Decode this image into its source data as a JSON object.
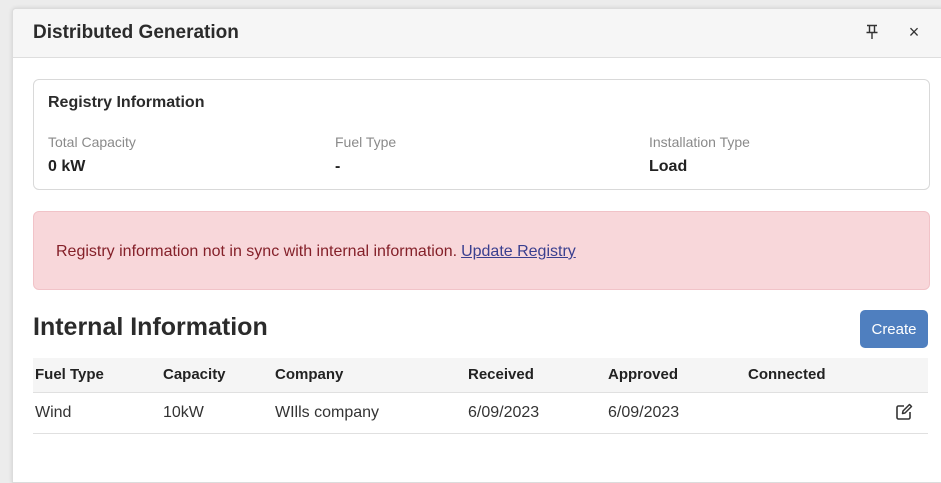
{
  "panel": {
    "title": "Distributed Generation",
    "close_label": "×"
  },
  "registry": {
    "title": "Registry Information",
    "fields": [
      {
        "label": "Total Capacity",
        "value": "0 kW"
      },
      {
        "label": "Fuel Type",
        "value": "-"
      },
      {
        "label": "Installation Type",
        "value": "Load"
      }
    ]
  },
  "alert": {
    "message": "Registry information not in sync with internal information.",
    "link_label": "Update Registry"
  },
  "internal": {
    "title": "Internal Information",
    "create_label": "Create",
    "columns": [
      "Fuel Type",
      "Capacity",
      "Company",
      "Received",
      "Approved",
      "Connected"
    ],
    "rows": [
      {
        "fuel_type": "Wind",
        "capacity": "10kW",
        "company": "WIlls company",
        "received": "6/09/2023",
        "approved": "6/09/2023",
        "connected": ""
      }
    ]
  },
  "icons": [
    "pin-icon",
    "close-icon",
    "edit-icon"
  ],
  "colors": {
    "alert_bg": "#f8d7da",
    "alert_text": "#842029",
    "primary_button": "#4f7fbf"
  }
}
